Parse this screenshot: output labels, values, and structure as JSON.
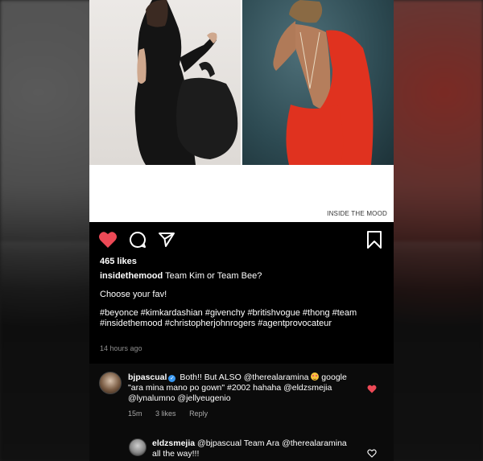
{
  "post": {
    "image_credit": "INSIDE THE MOOD",
    "likes": "465 likes",
    "username": "insidethemood",
    "caption_line1": "Team Kim or Team Bee?",
    "caption_line2": "Choose your fav!",
    "hashtags": "#beyonce #kimkardashian #givenchy #britishvogue #thong #team #insidethemood #christopherjohnrogers #agentprovocateur",
    "timestamp": "14 hours ago"
  },
  "actions": {
    "like_icon": "heart-filled-icon",
    "comment_icon": "comment-icon",
    "share_icon": "send-icon",
    "save_icon": "bookmark-icon"
  },
  "comments": [
    {
      "username": "bjpascual",
      "verified": true,
      "text_before_emoji": "Both!! But ALSO @therealaramina",
      "text_after_emoji": "google \"ara mina mano po gown\"  #2002 hahaha @eldzsmejia @lynalumno @jellyeugenio",
      "time": "15m",
      "likes": "3 likes",
      "reply_label": "Reply",
      "liked": true
    },
    {
      "username": "eldzsmejia",
      "text": "@bjpascual  Team Ara @therealaramina all the way!!!",
      "liked": false
    }
  ],
  "colors": {
    "like_red": "#ed4956",
    "meta_gray": "#8e8e8e",
    "verified_blue": "#3897f0"
  }
}
